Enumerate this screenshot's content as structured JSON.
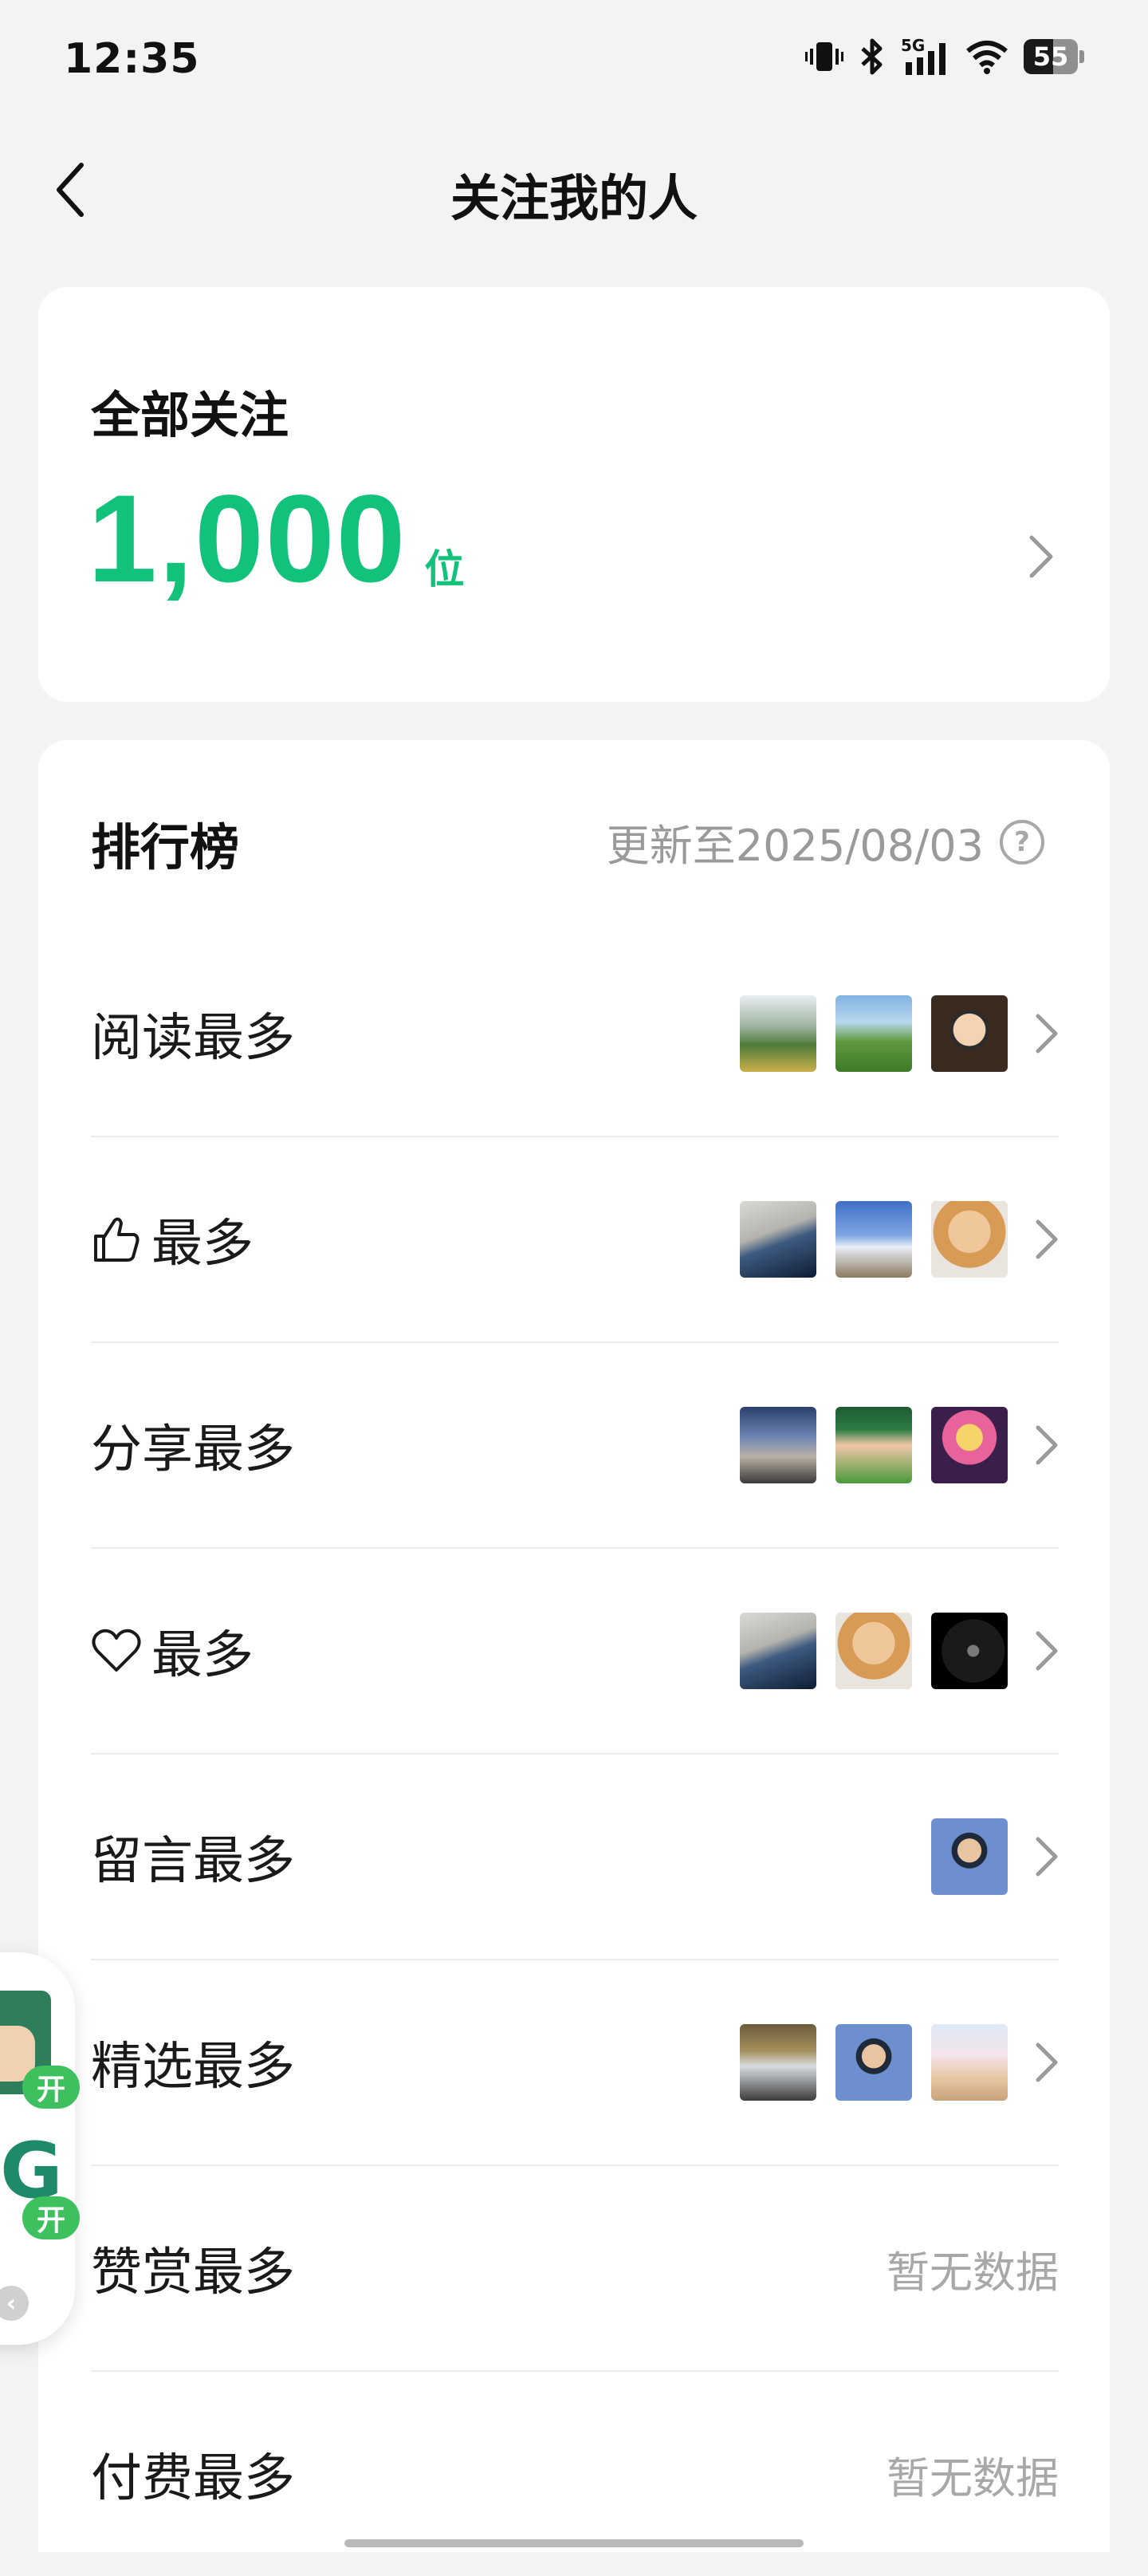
{
  "status_bar": {
    "time": "12:35",
    "battery_level": "55",
    "icons": [
      "vibrate-icon",
      "bluetooth-icon",
      "5g-signal-icon",
      "wifi-icon",
      "battery-icon"
    ]
  },
  "header": {
    "title": "关注我的人",
    "back_icon": "chevron-left-icon"
  },
  "total": {
    "label": "全部关注",
    "value": "1,000",
    "unit": "位"
  },
  "ranking": {
    "title": "排行榜",
    "updated": "更新至2025/08/03",
    "help": "?",
    "rows": [
      {
        "label": "阅读最多",
        "icon": null,
        "thumbs": [
          "lake-landscape",
          "green-hills",
          "cartoon-avatar"
        ]
      },
      {
        "label": "最多",
        "icon": "thumbs-up-icon",
        "thumbs": [
          "person-at-sea",
          "church-sky",
          "cats"
        ]
      },
      {
        "label": "分享最多",
        "icon": null,
        "thumbs": [
          "cathedral",
          "anime-scene",
          "sailor-moon"
        ]
      },
      {
        "label": "最多",
        "icon": "heart-icon",
        "thumbs": [
          "person-at-sea",
          "cats",
          "dark-circle"
        ]
      },
      {
        "label": "留言最多",
        "icon": null,
        "thumbs": [
          "portrait"
        ]
      },
      {
        "label": "精选最多",
        "icon": null,
        "thumbs": [
          "car-person",
          "portrait",
          "blossom"
        ]
      },
      {
        "label": "赞赏最多",
        "icon": null,
        "no_data": "暂无数据"
      },
      {
        "label": "付费最多",
        "icon": null,
        "no_data": "暂无数据"
      }
    ]
  },
  "floating_widget": {
    "badge": "开",
    "app2_letter": "G"
  },
  "colors": {
    "accent": "#13c27a",
    "background": "#f2f3f2",
    "muted_text": "#9a9a9a",
    "badge_green": "#3ec05e"
  }
}
